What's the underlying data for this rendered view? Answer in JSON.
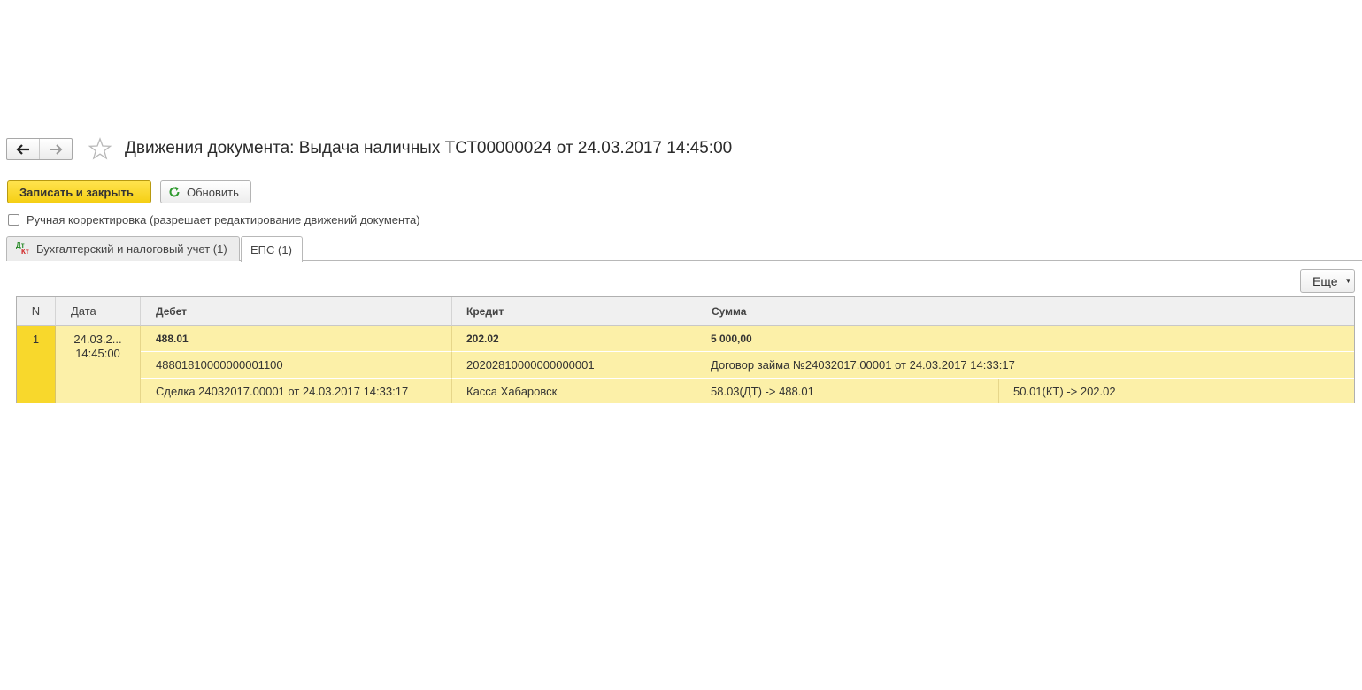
{
  "window": {
    "title": "Движения документа: Выдача наличных ТСТ00000024 от 24.03.2017 14:45:00"
  },
  "nav": {
    "back_icon": "arrow-left-icon",
    "forward_icon": "arrow-right-icon",
    "favorite_icon": "star-icon"
  },
  "toolbar": {
    "save_label": "Записать и закрыть",
    "refresh_label": "Обновить",
    "save_color": "#f5cf14"
  },
  "manual_edit": {
    "label": "Ручная корректировка (разрешает редактирование движений документа)",
    "checked": false
  },
  "tabs": [
    {
      "label": "Бухгалтерский и налоговый учет (1)",
      "icon": "dt-kt-icon",
      "active": false
    },
    {
      "label": "ЕПС (1)",
      "active": true
    }
  ],
  "more_label": "Еще",
  "table": {
    "columns": {
      "n": "N",
      "date": "Дата",
      "debit": "Дебет",
      "credit": "Кредит",
      "sum": "Сумма"
    },
    "rows": [
      {
        "n": "1",
        "date": "24.03.2...",
        "time": "14:45:00",
        "debit_account": "488.01",
        "credit_account": "202.02",
        "sum": "5 000,00",
        "debit_code": "48801810000000001100",
        "credit_code": "20202810000000000001",
        "contract": "Договор займа №24032017.00001 от 24.03.2017 14:33:17",
        "debit_subconto": "Сделка 24032017.00001 от 24.03.2017 14:33:17",
        "credit_subconto": "Касса Хабаровск",
        "dt_mapping": "58.03(ДТ) -> 488.01",
        "kt_mapping": "50.01(КТ) -> 202.02"
      }
    ]
  }
}
